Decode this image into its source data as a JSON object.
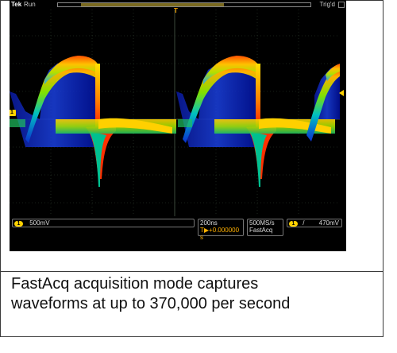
{
  "scope": {
    "brand": "Tek",
    "run_state": "Run",
    "trigger_state": "Trig'd",
    "trigger_marker": "T",
    "ch1_marker": "1",
    "bottom": {
      "ch1_label": "1",
      "ch1_scale": "500mV",
      "timebase": "200ns",
      "trigger_position": "T▶+0.000000 s",
      "sample_rate": "500MS/s",
      "acq_mode": "FastAcq",
      "trig_channel": "1",
      "trig_slope": "/",
      "trig_level": "470mV"
    },
    "colors": {
      "background": "#000000",
      "grid": "#2a3a2a",
      "ch1": "#ffd200",
      "persistence_hot": "#ff2a00",
      "persistence_warm": "#ffb000",
      "persistence_mid": "#9fe000",
      "persistence_cool": "#00b0ff",
      "persistence_cold": "#1030d0"
    }
  },
  "caption": {
    "line1": "FastAcq acquisition mode captures",
    "line2": "waveforms at up to 370,000 per second"
  }
}
